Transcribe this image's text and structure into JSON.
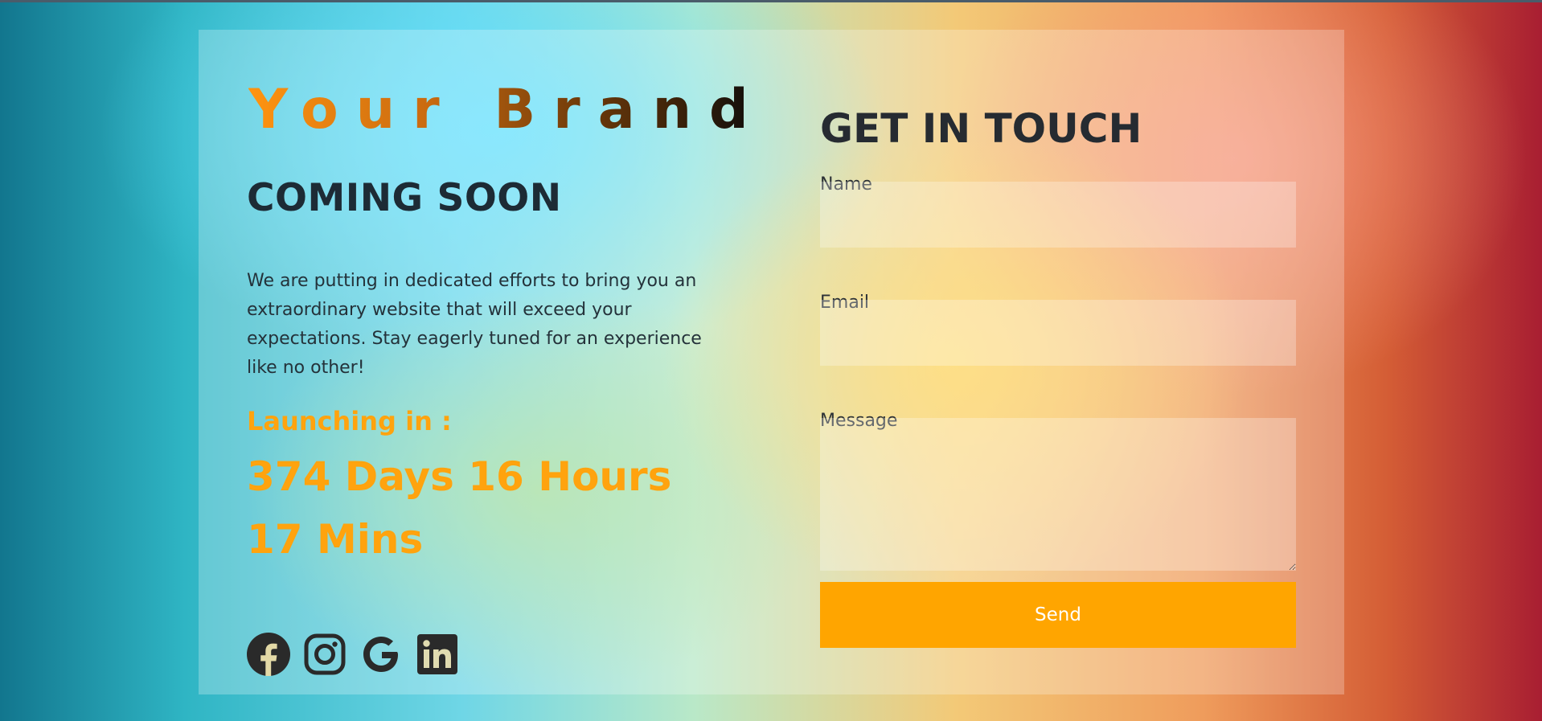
{
  "brand": {
    "name": "Your Brand",
    "gradient_colors": [
      "#ff9410",
      "#0b0b0b"
    ]
  },
  "hero": {
    "heading": "COMING SOON",
    "description": "We are putting in dedicated efforts to bring you an extraordinary website that will exceed your expectations. Stay eagerly tuned for an experience like no other!",
    "launch_label": "Launching in :",
    "countdown": "374 Days 16 Hours 17 Mins"
  },
  "social": [
    {
      "icon": "facebook-icon"
    },
    {
      "icon": "instagram-icon"
    },
    {
      "icon": "google-icon"
    },
    {
      "icon": "linkedin-icon"
    }
  ],
  "contact": {
    "heading": "GET IN TOUCH",
    "name_label": "Name",
    "name_value": "",
    "email_label": "Email",
    "email_value": "",
    "message_label": "Message",
    "message_value": "",
    "send_label": "Send"
  },
  "colors": {
    "accent": "#ffa500",
    "heading_dark": "#1d2b35",
    "social_icon": "#2a2a2a"
  }
}
